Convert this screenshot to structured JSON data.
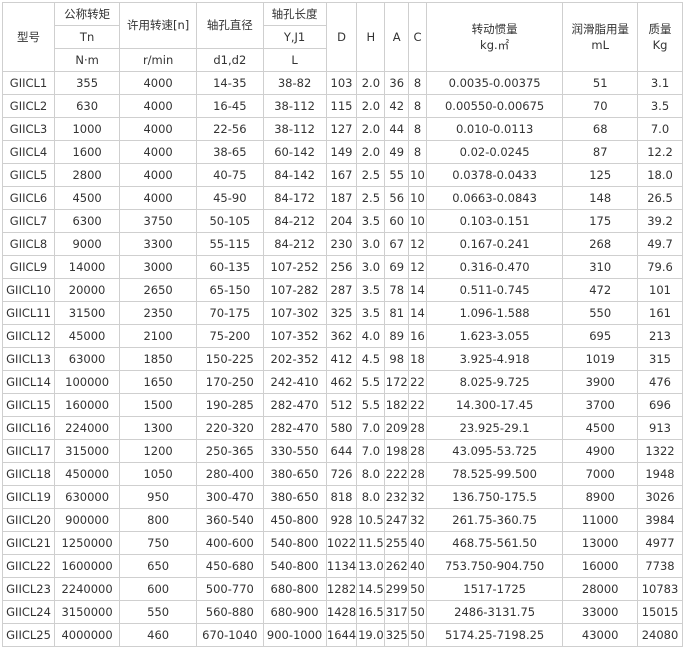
{
  "header": {
    "model": "型号",
    "torque": {
      "label": "公称转矩",
      "sym": "Tn",
      "unit": "N·m"
    },
    "speed": {
      "label": "许用转速[n]",
      "unit": "r/min"
    },
    "bore": {
      "label": "轴孔直径",
      "sym": "d1,d2"
    },
    "length": {
      "label": "轴孔长度",
      "sym": "Y,J1",
      "unit": "L"
    },
    "d": "D",
    "h": "H",
    "a": "A",
    "c": "C",
    "inertia": {
      "label": "转动惯量",
      "unit": "kg.㎡"
    },
    "grease": {
      "label": "润滑脂用量",
      "unit": "mL"
    },
    "mass": {
      "label": "质量",
      "unit": "Kg"
    }
  },
  "rows": [
    [
      "GIICL1",
      "355",
      "4000",
      "14-35",
      "38-82",
      "103",
      "2.0",
      "36",
      "8",
      "0.0035-0.00375",
      "51",
      "3.1"
    ],
    [
      "GIICL2",
      "630",
      "4000",
      "16-45",
      "38-112",
      "115",
      "2.0",
      "42",
      "8",
      "0.00550-0.00675",
      "70",
      "3.5"
    ],
    [
      "GIICL3",
      "1000",
      "4000",
      "22-56",
      "38-112",
      "127",
      "2.0",
      "44",
      "8",
      "0.010-0.0113",
      "68",
      "7.0"
    ],
    [
      "GIICL4",
      "1600",
      "4000",
      "38-65",
      "60-142",
      "149",
      "2.0",
      "49",
      "8",
      "0.02-0.0245",
      "87",
      "12.2"
    ],
    [
      "GIICL5",
      "2800",
      "4000",
      "40-75",
      "84-142",
      "167",
      "2.5",
      "55",
      "10",
      "0.0378-0.0433",
      "125",
      "18.0"
    ],
    [
      "GIICL6",
      "4500",
      "4000",
      "45-90",
      "84-172",
      "187",
      "2.5",
      "56",
      "10",
      "0.0663-0.0843",
      "148",
      "26.5"
    ],
    [
      "GIICL7",
      "6300",
      "3750",
      "50-105",
      "84-212",
      "204",
      "3.5",
      "60",
      "10",
      "0.103-0.151",
      "175",
      "39.2"
    ],
    [
      "GIICL8",
      "9000",
      "3300",
      "55-115",
      "84-212",
      "230",
      "3.0",
      "67",
      "12",
      "0.167-0.241",
      "268",
      "49.7"
    ],
    [
      "GIICL9",
      "14000",
      "3000",
      "60-135",
      "107-252",
      "256",
      "3.0",
      "69",
      "12",
      "0.316-0.470",
      "310",
      "79.6"
    ],
    [
      "GIICL10",
      "20000",
      "2650",
      "65-150",
      "107-282",
      "287",
      "3.5",
      "78",
      "14",
      "0.511-0.745",
      "472",
      "101"
    ],
    [
      "GIICL11",
      "31500",
      "2350",
      "70-175",
      "107-302",
      "325",
      "3.5",
      "81",
      "14",
      "1.096-1.588",
      "550",
      "161"
    ],
    [
      "GIICL12",
      "45000",
      "2100",
      "75-200",
      "107-352",
      "362",
      "4.0",
      "89",
      "16",
      "1.623-3.055",
      "695",
      "213"
    ],
    [
      "GIICL13",
      "63000",
      "1850",
      "150-225",
      "202-352",
      "412",
      "4.5",
      "98",
      "18",
      "3.925-4.918",
      "1019",
      "315"
    ],
    [
      "GIICL14",
      "100000",
      "1650",
      "170-250",
      "242-410",
      "462",
      "5.5",
      "172",
      "22",
      "8.025-9.725",
      "3900",
      "476"
    ],
    [
      "GIICL15",
      "160000",
      "1500",
      "190-285",
      "282-470",
      "512",
      "5.5",
      "182",
      "22",
      "14.300-17.45",
      "3700",
      "696"
    ],
    [
      "GIICL16",
      "224000",
      "1300",
      "220-320",
      "282-470",
      "580",
      "7.0",
      "209",
      "28",
      "23.925-29.1",
      "4500",
      "913"
    ],
    [
      "GIICL17",
      "315000",
      "1200",
      "250-365",
      "330-550",
      "644",
      "7.0",
      "198",
      "28",
      "43.095-53.725",
      "4900",
      "1322"
    ],
    [
      "GIICL18",
      "450000",
      "1050",
      "280-400",
      "380-650",
      "726",
      "8.0",
      "222",
      "28",
      "78.525-99.500",
      "7000",
      "1948"
    ],
    [
      "GIICL19",
      "630000",
      "950",
      "300-470",
      "380-650",
      "818",
      "8.0",
      "232",
      "32",
      "136.750-175.5",
      "8900",
      "3026"
    ],
    [
      "GIICL20",
      "900000",
      "800",
      "360-540",
      "450-800",
      "928",
      "10.5",
      "247",
      "32",
      "261.75-360.75",
      "11000",
      "3984"
    ],
    [
      "GIICL21",
      "1250000",
      "750",
      "400-600",
      "540-800",
      "1022",
      "11.5",
      "255",
      "40",
      "468.75-561.50",
      "13000",
      "4977"
    ],
    [
      "GIICL22",
      "1600000",
      "650",
      "450-680",
      "540-800",
      "1134",
      "13.0",
      "262",
      "40",
      "753.750-904.750",
      "16000",
      "7738"
    ],
    [
      "GIICL23",
      "2240000",
      "600",
      "500-770",
      "680-800",
      "1282",
      "14.5",
      "299",
      "50",
      "1517-1725",
      "28000",
      "10783"
    ],
    [
      "GIICL24",
      "3150000",
      "550",
      "560-880",
      "680-900",
      "1428",
      "16.5",
      "317",
      "50",
      "2486-3131.75",
      "33000",
      "15015"
    ],
    [
      "GIICL25",
      "4000000",
      "460",
      "670-1040",
      "900-1000",
      "1644",
      "19.0",
      "325",
      "50",
      "5174.25-7198.25",
      "43000",
      "24080"
    ]
  ]
}
